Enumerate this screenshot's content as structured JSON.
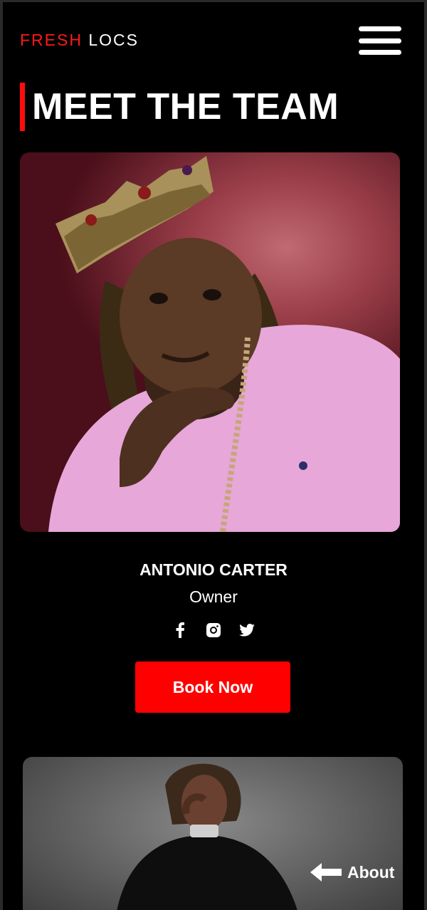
{
  "header": {
    "logo_part1": "FRESH",
    "logo_part2": "LOCS"
  },
  "page": {
    "title": "MEET THE TEAM"
  },
  "team": [
    {
      "name": "ANTONIO CARTER",
      "role": "Owner",
      "cta": "Book Now"
    }
  ],
  "floating_link": {
    "label": "About"
  },
  "icons": {
    "menu": "hamburger-icon",
    "facebook": "facebook-icon",
    "instagram": "instagram-icon",
    "twitter": "twitter-icon",
    "arrow": "arrow-left-icon"
  },
  "colors": {
    "accent": "#ff0000",
    "background": "#000000",
    "text": "#ffffff"
  }
}
